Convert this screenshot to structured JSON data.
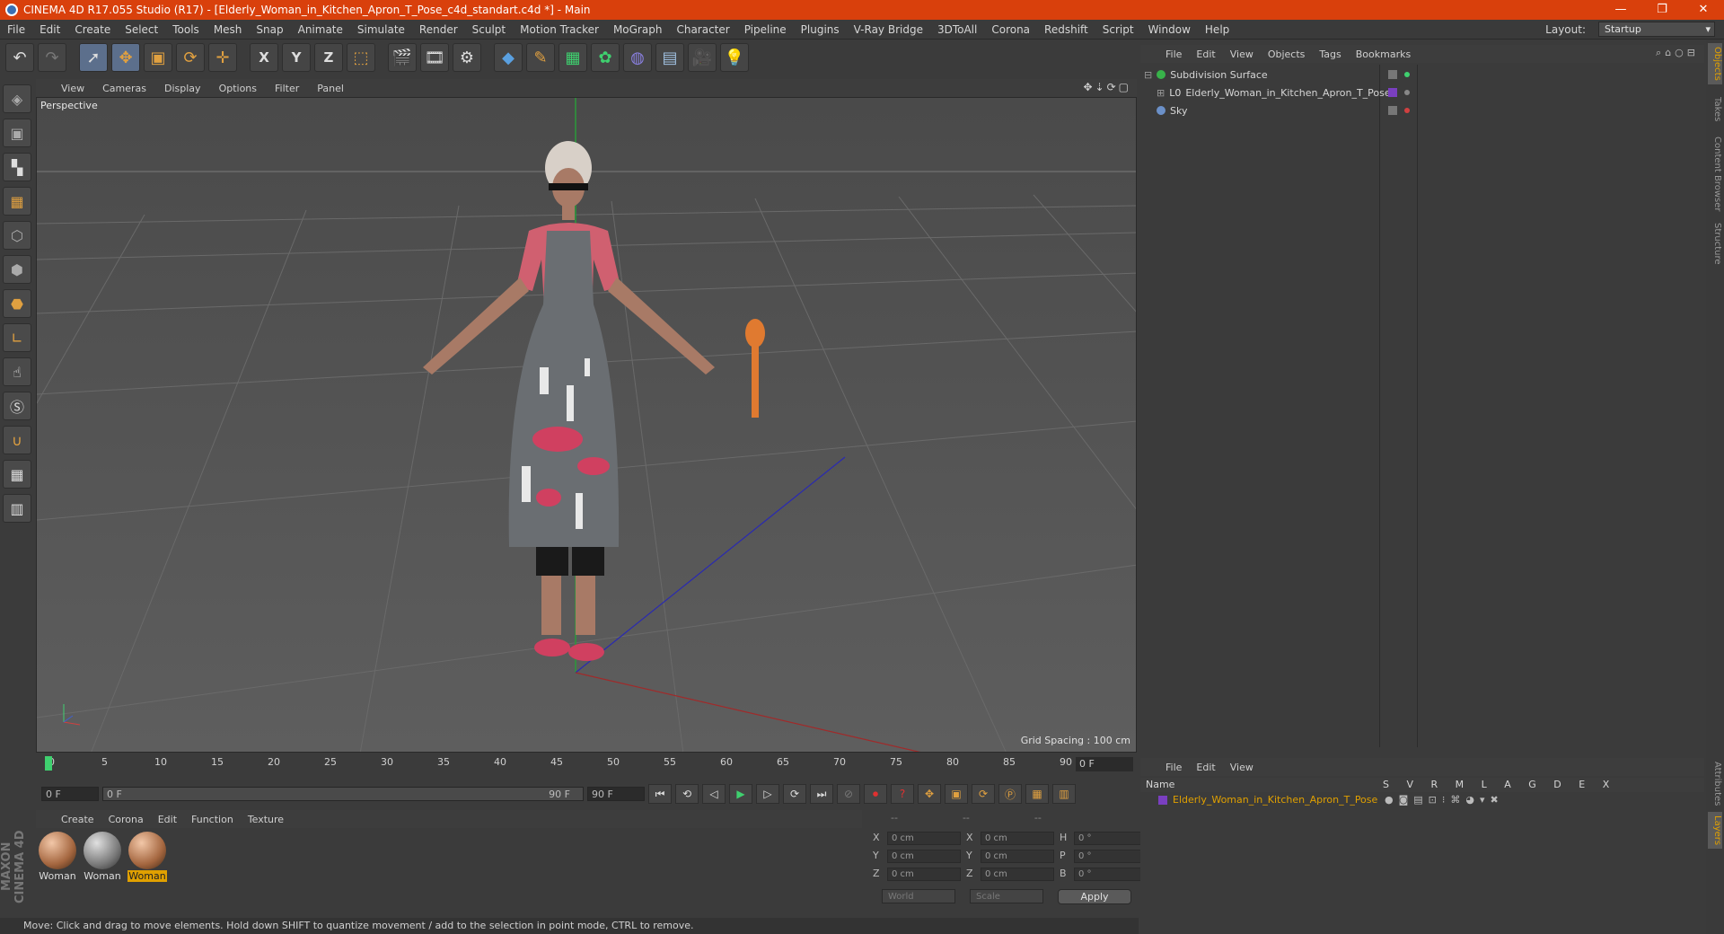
{
  "window": {
    "title": "CINEMA 4D R17.055 Studio (R17) - [Elderly_Woman_in_Kitchen_Apron_T_Pose_c4d_standart.c4d *] - Main",
    "controls": [
      "—",
      "❐",
      "✕"
    ]
  },
  "menubar": {
    "items": [
      "File",
      "Edit",
      "Create",
      "Select",
      "Tools",
      "Mesh",
      "Snap",
      "Animate",
      "Simulate",
      "Render",
      "Sculpt",
      "Motion Tracker",
      "MoGraph",
      "Character",
      "Pipeline",
      "Plugins",
      "V-Ray Bridge",
      "3DToAll",
      "Corona",
      "Redshift",
      "Script",
      "Window",
      "Help"
    ],
    "layout_label": "Layout:",
    "layout_value": "Startup"
  },
  "toolbar": {
    "icons": [
      "undo-icon",
      "redo-icon",
      "select-icon",
      "move-icon",
      "scale-icon",
      "rotate-icon",
      "live-select-icon",
      "x-axis-icon",
      "y-axis-icon",
      "z-axis-icon",
      "coordinate-system-icon",
      "render-view-icon",
      "render-picture-viewer-icon",
      "edit-render-settings-icon",
      "cube-icon",
      "pen-icon",
      "subdivision-icon",
      "array-icon",
      "deformer-icon",
      "floor-icon",
      "camera-icon",
      "light-icon"
    ],
    "axis_labels": [
      "X",
      "Y",
      "Z"
    ]
  },
  "viewport": {
    "menu": [
      "View",
      "Cameras",
      "Display",
      "Options",
      "Filter",
      "Panel"
    ],
    "camera_label": "Perspective",
    "grid_spacing": "Grid Spacing : 100 cm"
  },
  "timeline": {
    "ticks": [
      "0",
      "5",
      "10",
      "15",
      "20",
      "25",
      "30",
      "35",
      "40",
      "45",
      "50",
      "55",
      "60",
      "65",
      "70",
      "75",
      "80",
      "85",
      "90"
    ],
    "current_frame": "0 F",
    "start_frame": "0 F",
    "range_start": "0 F",
    "range_end": "90 F",
    "end_frame": "90 F"
  },
  "materials": {
    "menu": [
      "Create",
      "Corona",
      "Edit",
      "Function",
      "Texture"
    ],
    "items": [
      {
        "label": "Woman",
        "selected": false,
        "style": "skin"
      },
      {
        "label": "Woman",
        "selected": false,
        "style": "grey"
      },
      {
        "label": "Woman",
        "selected": true,
        "style": "skin"
      }
    ]
  },
  "coords": {
    "headers": [
      "--",
      "--",
      "--"
    ],
    "rows": [
      {
        "a1": "X",
        "v1": "0 cm",
        "a2": "X",
        "v2": "0 cm",
        "a3": "H",
        "v3": "0 °"
      },
      {
        "a1": "Y",
        "v1": "0 cm",
        "a2": "Y",
        "v2": "0 cm",
        "a3": "P",
        "v3": "0 °"
      },
      {
        "a1": "Z",
        "v1": "0 cm",
        "a2": "Z",
        "v2": "0 cm",
        "a3": "B",
        "v3": "0 °"
      }
    ],
    "world": "World",
    "scale": "Scale",
    "apply": "Apply"
  },
  "status": "Move: Click and drag to move elements. Hold down SHIFT to quantize movement / add to the selection in point mode, CTRL to remove.",
  "branding": "MAXON CINEMA 4D",
  "object_manager": {
    "menu": [
      "File",
      "Edit",
      "View",
      "Objects",
      "Tags",
      "Bookmarks"
    ],
    "objects": [
      {
        "name": "Subdivision Surface",
        "color": "#38b24a"
      },
      {
        "name": "Elderly_Woman_in_Kitchen_Apron_T_Pose",
        "color": "#c8c8c8"
      },
      {
        "name": "Sky",
        "color": "#6b90c8"
      }
    ]
  },
  "right_tabs": [
    "Objects",
    "Takes",
    "Content Browser",
    "Structure",
    "Attributes",
    "Layers"
  ],
  "layers": {
    "menu": [
      "File",
      "Edit",
      "View"
    ],
    "name_header": "Name",
    "columns": "S V R M L A G D E X",
    "row": "Elderly_Woman_in_Kitchen_Apron_T_Pose",
    "row_color": "#7a3fc0"
  }
}
